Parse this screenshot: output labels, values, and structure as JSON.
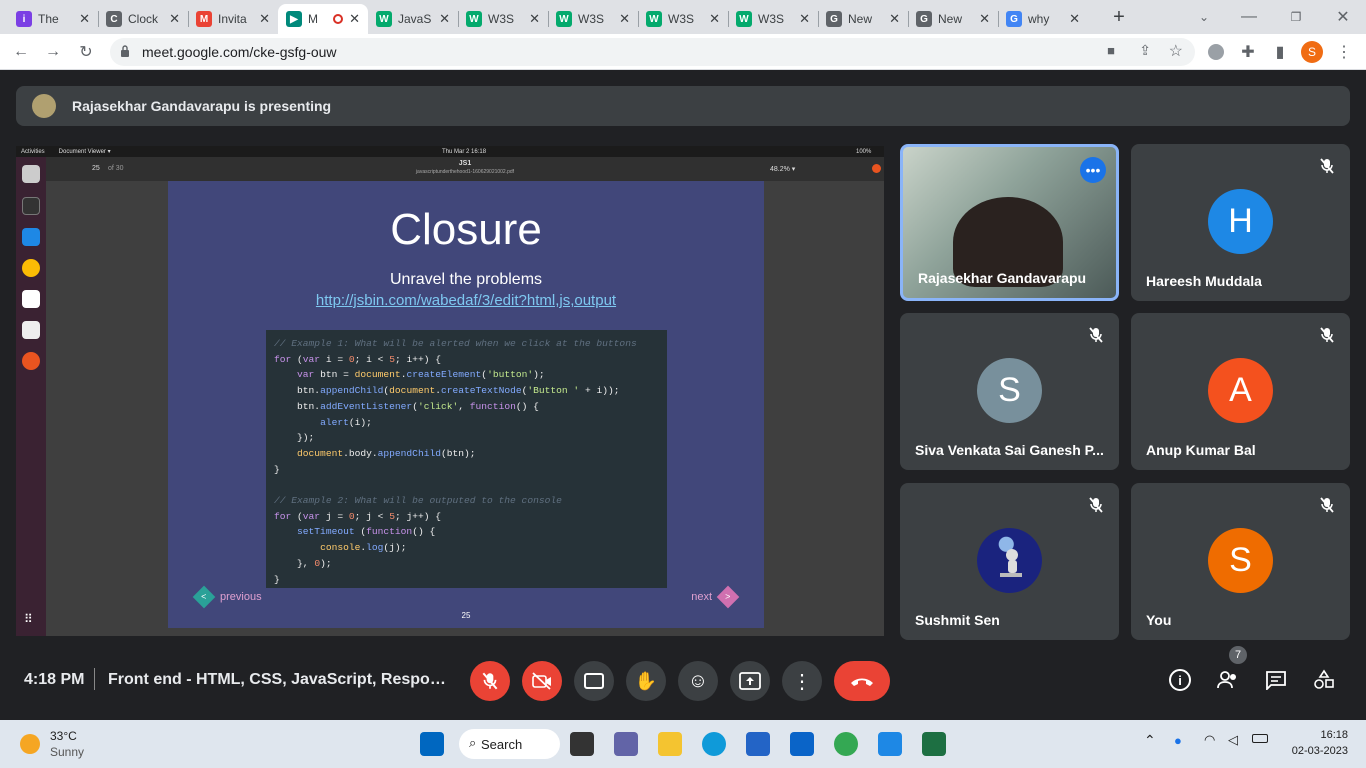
{
  "browser": {
    "tabs": [
      {
        "title": "The",
        "color": "#7b3fe4",
        "glyph": "i"
      },
      {
        "title": "Clock",
        "color": "#5f6368",
        "glyph": "C"
      },
      {
        "title": "Invita",
        "color": "#ea4335",
        "glyph": "M"
      },
      {
        "title": "M",
        "color": "#00897b",
        "glyph": "▶",
        "active": true
      },
      {
        "title": "JavaS",
        "color": "#04aa6d",
        "glyph": "W"
      },
      {
        "title": "W3S",
        "color": "#04aa6d",
        "glyph": "W"
      },
      {
        "title": "W3S",
        "color": "#04aa6d",
        "glyph": "W"
      },
      {
        "title": "W3S",
        "color": "#04aa6d",
        "glyph": "W"
      },
      {
        "title": "W3S",
        "color": "#04aa6d",
        "glyph": "W"
      },
      {
        "title": "New",
        "color": "#5f6368",
        "glyph": "G"
      },
      {
        "title": "New",
        "color": "#5f6368",
        "glyph": "G"
      },
      {
        "title": "why",
        "color": "#4285f4",
        "glyph": "G"
      }
    ],
    "url": "meet.google.com/cke-gsfg-ouw",
    "profile_initial": "S"
  },
  "meet": {
    "presenting_banner": "Rajasekhar Gandavarapu is presenting",
    "ubuntu": {
      "activities": "Activities",
      "app_menu": "Document Viewer ▾",
      "datetime": "Thu Mar 2  16:18",
      "battery": "100%",
      "doc_title": "JS1",
      "doc_file": "javascriptunderthehood1-160629021002.pdf",
      "page_input": "25",
      "page_of": "of 30",
      "zoom": "48.2% ▾"
    },
    "slide": {
      "title": "Closure",
      "subtitle": "Unravel the problems",
      "link": "http://jsbin.com/wabedaf/3/edit?html,js,output",
      "prev": "previous",
      "next": "next",
      "prev_arrow": "<",
      "next_arrow": ">",
      "page": "25"
    },
    "participants": [
      {
        "name": "Rajasekhar Gandavarapu",
        "type": "video"
      },
      {
        "name": "Hareesh Muddala",
        "initial": "H",
        "color": "#1e88e5"
      },
      {
        "name": "Siva Venkata Sai Ganesh P...",
        "initial": "S",
        "color": "#78909c"
      },
      {
        "name": "Anup Kumar Bal",
        "initial": "A",
        "color": "#f4511e"
      },
      {
        "name": "Sushmit Sen",
        "initial": "",
        "color": "#1a237e"
      },
      {
        "name": "You",
        "initial": "S",
        "color": "#ef6c00"
      }
    ],
    "controls": {
      "time": "4:18 PM",
      "meeting_name": "Front end - HTML, CSS, JavaScript, Respon...",
      "people_count": "7"
    }
  },
  "taskbar": {
    "temp": "33°C",
    "weather": "Sunny",
    "search": "Search",
    "time": "16:18",
    "date": "02-03-2023"
  }
}
